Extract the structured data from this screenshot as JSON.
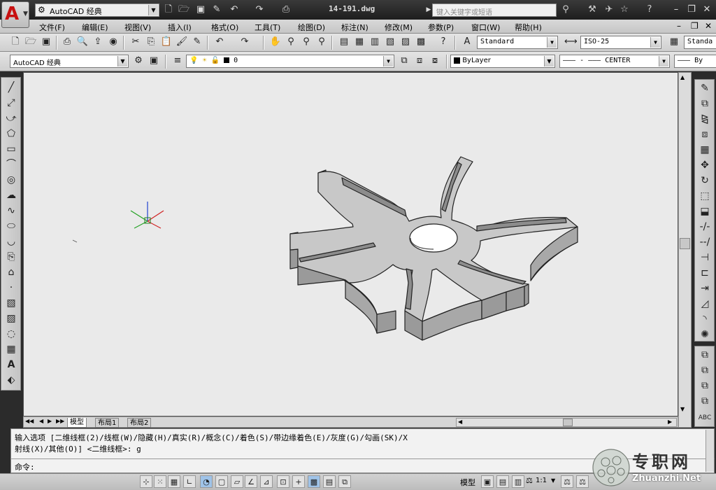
{
  "titlebar": {
    "workspace": "AutoCAD 经典",
    "document_title": "14-191.dwg",
    "search_placeholder": "键入关键字或短语"
  },
  "menu": [
    "文件(F)",
    "编辑(E)",
    "视图(V)",
    "插入(I)",
    "格式(O)",
    "工具(T)",
    "绘图(D)",
    "标注(N)",
    "修改(M)",
    "参数(P)",
    "窗口(W)",
    "帮助(H)"
  ],
  "styles": {
    "text_style": "Standard",
    "dim_style": "ISO-25",
    "table_style": "Standa"
  },
  "layers": {
    "workspace_combo": "AutoCAD 经典",
    "current_layer": "0",
    "color": "ByLayer",
    "linetype": "CENTER",
    "lineweight": "By"
  },
  "tabs": [
    "模型",
    "布局1",
    "布局2"
  ],
  "command": {
    "line1": "输入选项 [二维线框(2)/线框(W)/隐藏(H)/真实(R)/概念(C)/着色(S)/带边缘着色(E)/灰度(G)/勾画(SK)/X",
    "line2": "射线(X)/其他(O)] <二维线框>: g",
    "prompt": "命令:"
  },
  "statusbar": {
    "model_label": "模型",
    "scale": "1:1"
  },
  "watermark": {
    "brand": "专职网",
    "url": "Zhuanzhi.Net"
  },
  "colors": {
    "accent_red": "#c81010",
    "canvas_bg": "#eaeaea",
    "part_fill": "#c8c8c8"
  }
}
